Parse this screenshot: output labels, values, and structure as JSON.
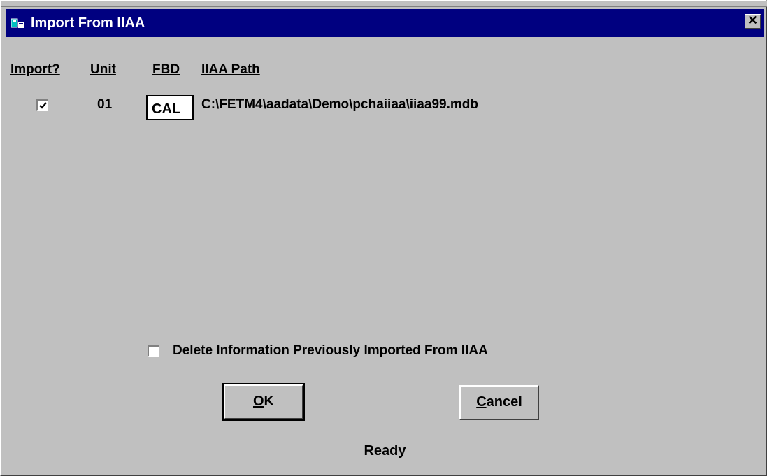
{
  "window": {
    "title": "Import From IIAA",
    "close_label": "✕"
  },
  "columns": {
    "import": "Import?",
    "unit": "Unit",
    "fbd": "FBD",
    "path": "IIAA Path"
  },
  "rows": [
    {
      "import_checked": true,
      "unit": "01",
      "fbd": "CAL",
      "path": "C:\\FETM4\\aadata\\Demo\\pchaiiaa\\iiaa99.mdb"
    }
  ],
  "delete_option": {
    "label": "Delete Information Previously Imported From IIAA",
    "checked": false
  },
  "buttons": {
    "ok_mnemonic": "O",
    "ok_rest": "K",
    "cancel_mnemonic": "C",
    "cancel_rest": "ancel"
  },
  "status": "Ready",
  "colors": {
    "titlebar": "#000080",
    "face": "#c0c0c0"
  },
  "icons": {
    "app": "app-window-icon",
    "check": "check-mark-icon"
  }
}
